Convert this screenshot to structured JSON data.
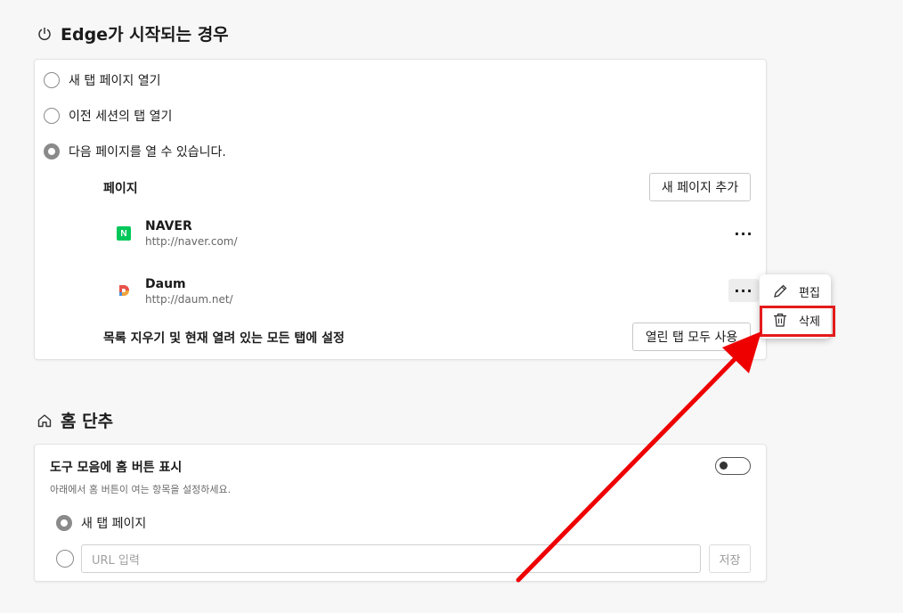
{
  "startup": {
    "title": "Edge가 시작되는 경우",
    "options": [
      {
        "label": "새 탭 페이지 열기",
        "checked": false
      },
      {
        "label": "이전 세션의 탭 열기",
        "checked": false
      },
      {
        "label": "다음 페이지를 열 수 있습니다.",
        "checked": true
      }
    ],
    "pages_label": "페이지",
    "add_page_button": "새 페이지 추가",
    "pages": [
      {
        "name": "NAVER",
        "url": "http://naver.com/",
        "icon": "naver-logo-icon",
        "color": "#03c75a"
      },
      {
        "name": "Daum",
        "url": "http://daum.net/",
        "icon": "daum-logo-icon"
      }
    ],
    "more_label": "···",
    "clear_label": "목록 지우기 및 현재 열려 있는 모든 탭에 설정",
    "use_all_tabs_button": "열린 탭 모두 사용"
  },
  "context_menu": {
    "items": [
      {
        "label": "편집",
        "icon": "pencil-icon"
      },
      {
        "label": "삭제",
        "icon": "trash-icon"
      }
    ],
    "highlight_color": "#e41b1b"
  },
  "home": {
    "title": "홈 단추",
    "show_label": "도구 모음에 홈 버튼 표시",
    "description": "아래에서 홈 버튼이 여는 항목을 설정하세요.",
    "toggle_on": false,
    "options": [
      {
        "label": "새 탭 페이지",
        "checked": true
      }
    ],
    "url_placeholder": "URL 입력",
    "save_button": "저장"
  },
  "annotation": {
    "arrow_color": "#ee0000"
  }
}
